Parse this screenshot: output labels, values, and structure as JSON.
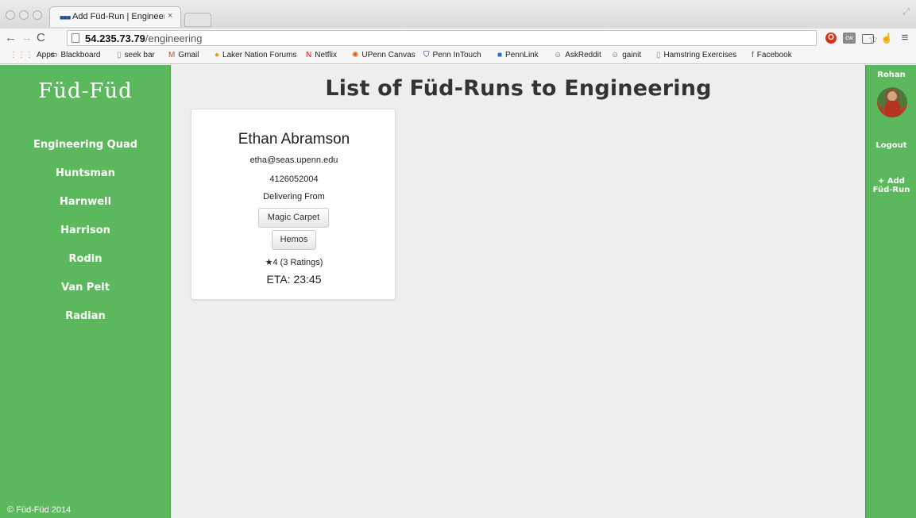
{
  "browser": {
    "tab_title": "Add Füd-Run | Engineering",
    "tab_favicon": "■■■",
    "tab_close": "×",
    "url_host": "54.235.73.79",
    "url_path": "/engineering",
    "nav_back": "←",
    "nav_forward": "→",
    "nav_reload": "C",
    "star": "☆",
    "ext_opera": "O",
    "ext_cw": "cw",
    "ext_hand": "☝",
    "ext_menu": "≡",
    "resize": "⤢"
  },
  "bookmarks": [
    {
      "label": "Apps",
      "icon": "apps-grid-icon",
      "glyph": "⋮⋮⋮",
      "color": "#e0a800"
    },
    {
      "label": "Blackboard",
      "icon": "blackboard-icon",
      "glyph": "▭",
      "color": "#333333"
    },
    {
      "label": "seek bar",
      "icon": "page-icon",
      "glyph": "▯",
      "color": "#888888"
    },
    {
      "label": "Gmail",
      "icon": "gmail-icon",
      "glyph": "M",
      "color": "#d44638"
    },
    {
      "label": "Laker Nation Forums",
      "icon": "laker-icon",
      "glyph": "●",
      "color": "#e4a11b"
    },
    {
      "label": "Netflix",
      "icon": "netflix-icon",
      "glyph": "N",
      "color": "#e50914"
    },
    {
      "label": "UPenn Canvas",
      "icon": "canvas-icon",
      "glyph": "✺",
      "color": "#e66000"
    },
    {
      "label": "Penn InTouch",
      "icon": "penn-shield-icon",
      "glyph": "⛉",
      "color": "#011f5b"
    },
    {
      "label": "PennLink",
      "icon": "pennlink-icon",
      "glyph": "■",
      "color": "#1f6fd6"
    },
    {
      "label": "AskReddit",
      "icon": "reddit-icon",
      "glyph": "☺",
      "color": "#555555"
    },
    {
      "label": "gainit",
      "icon": "reddit-icon",
      "glyph": "☺",
      "color": "#555555"
    },
    {
      "label": "Hamstring Exercises",
      "icon": "page-icon",
      "glyph": "▯",
      "color": "#888888"
    },
    {
      "label": "Facebook",
      "icon": "facebook-icon",
      "glyph": "f",
      "color": "#3b5998"
    }
  ],
  "app": {
    "logo": "Füd-Füd",
    "nav": [
      "Engineering Quad",
      "Huntsman",
      "Harnwell",
      "Harrison",
      "Rodin",
      "Van Pelt",
      "Radian"
    ],
    "copyright": "© Füd-Füd 2014",
    "user_name": "Rohan",
    "logout": "Logout",
    "add_run_line1": "+ Add",
    "add_run_line2": "Füd-Run",
    "title": "List of Füd-Runs to Engineering"
  },
  "runs": [
    {
      "name": "Ethan Abramson",
      "email": "etha@seas.upenn.edu",
      "phone": "4126052004",
      "delivering_label": "Delivering From",
      "places": [
        "Magic Carpet",
        "Hemos"
      ],
      "rating": "★4 (3 Ratings)",
      "eta": "ETA: 23:45"
    }
  ],
  "colors": {
    "sidebar_green": "#5cb85c",
    "page_bg": "#eeeeee",
    "title_text": "#333333"
  }
}
